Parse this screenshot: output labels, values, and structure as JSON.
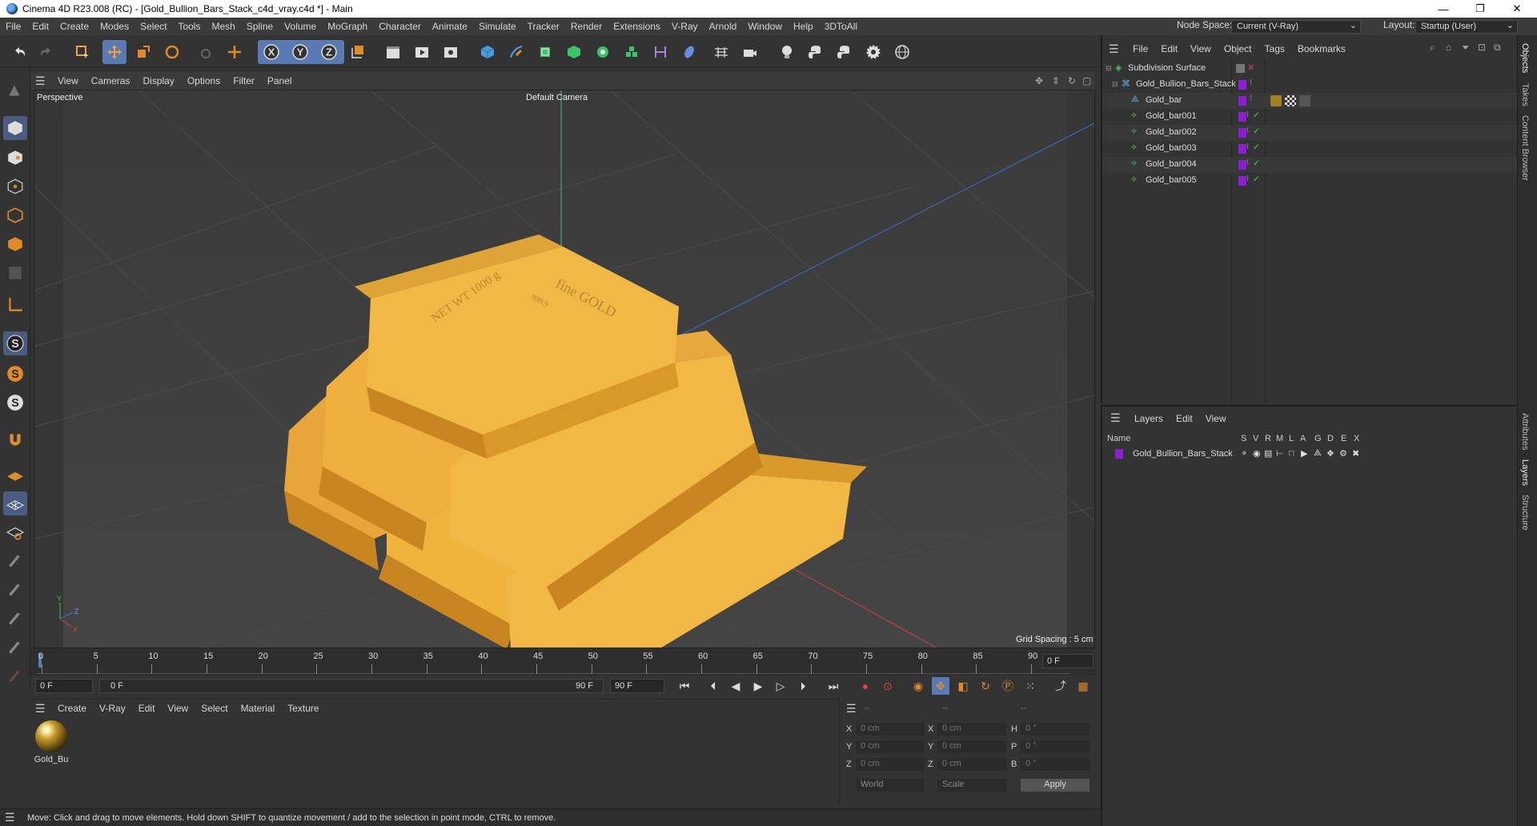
{
  "window": {
    "title": "Cinema 4D R23.008 (RC) - [Gold_Bullion_Bars_Stack_c4d_vray.c4d *] - Main",
    "minimize": "—",
    "maximize": "❐",
    "close": "✕"
  },
  "menubar": {
    "items": [
      "File",
      "Edit",
      "Create",
      "Modes",
      "Select",
      "Tools",
      "Mesh",
      "Spline",
      "Volume",
      "MoGraph",
      "Character",
      "Animate",
      "Simulate",
      "Tracker",
      "Render",
      "Extensions",
      "V-Ray",
      "Arnold",
      "Window",
      "Help",
      "3DToAll"
    ],
    "node_space_label": "Node Space:",
    "node_space_value": "Current (V-Ray)",
    "layout_label": "Layout:",
    "layout_value": "Startup (User)"
  },
  "toolbar": {
    "axis_x": "X",
    "axis_y": "Y",
    "axis_z": "Z"
  },
  "viewport": {
    "menu": [
      "View",
      "Cameras",
      "Display",
      "Options",
      "Filter",
      "Panel"
    ],
    "view_name": "Perspective",
    "camera_name": "Default Camera",
    "grid_spacing": "Grid Spacing : 5 cm",
    "bar_text_brand": "fine GOLD",
    "bar_text_purity": "999.9",
    "bar_text_weight": "NET WT 1000 g"
  },
  "timeline": {
    "ticks": [
      "0",
      "5",
      "10",
      "15",
      "20",
      "25",
      "30",
      "35",
      "40",
      "45",
      "50",
      "55",
      "60",
      "65",
      "70",
      "75",
      "80",
      "85",
      "90"
    ],
    "current_frame_right": "0 F",
    "start_field": "0 F",
    "range_start": "0 F",
    "range_end": "90 F",
    "end_field": "90 F"
  },
  "material_manager": {
    "menu": [
      "Create",
      "V-Ray",
      "Edit",
      "View",
      "Select",
      "Material",
      "Texture"
    ],
    "material_name": "Gold_Bu"
  },
  "coordinates": {
    "header_cols": [
      "--",
      "--",
      "--"
    ],
    "rows": [
      {
        "a": "X",
        "av": "0 cm",
        "b": "X",
        "bv": "0 cm",
        "c": "H",
        "cv": "0 °"
      },
      {
        "a": "Y",
        "av": "0 cm",
        "b": "Y",
        "bv": "0 cm",
        "c": "P",
        "cv": "0 °"
      },
      {
        "a": "Z",
        "av": "0 cm",
        "b": "Z",
        "bv": "0 cm",
        "c": "B",
        "cv": "0 °"
      }
    ],
    "mode": "World",
    "transform": "Scale",
    "apply": "Apply"
  },
  "status": {
    "text": "Move: Click and drag to move elements. Hold down SHIFT to quantize movement / add to the selection in point mode, CTRL to remove."
  },
  "object_manager": {
    "menu": [
      "File",
      "Edit",
      "View",
      "Object",
      "Tags",
      "Bookmarks"
    ],
    "objects": [
      {
        "name": "Subdivision Surface"
      },
      {
        "name": "Gold_Bullion_Bars_Stack"
      },
      {
        "name": "Gold_bar"
      },
      {
        "name": "Gold_bar001"
      },
      {
        "name": "Gold_bar002"
      },
      {
        "name": "Gold_bar003"
      },
      {
        "name": "Gold_bar004"
      },
      {
        "name": "Gold_bar005"
      }
    ]
  },
  "layer_manager": {
    "menu": [
      "Layers",
      "Edit",
      "View"
    ],
    "columns": [
      "Name",
      "S",
      "V",
      "R",
      "M",
      "L",
      "A",
      "G",
      "D",
      "E",
      "X"
    ],
    "layers": [
      {
        "name": "Gold_Bullion_Bars_Stack"
      }
    ]
  },
  "side_tabs": [
    "Objects",
    "Takes",
    "Content Browser",
    "Attributes",
    "Layers",
    "Structure"
  ],
  "colors": {
    "accent": "#5a7ab3",
    "layer_color": "#8b1fd4",
    "gold": "#f0b43c"
  }
}
